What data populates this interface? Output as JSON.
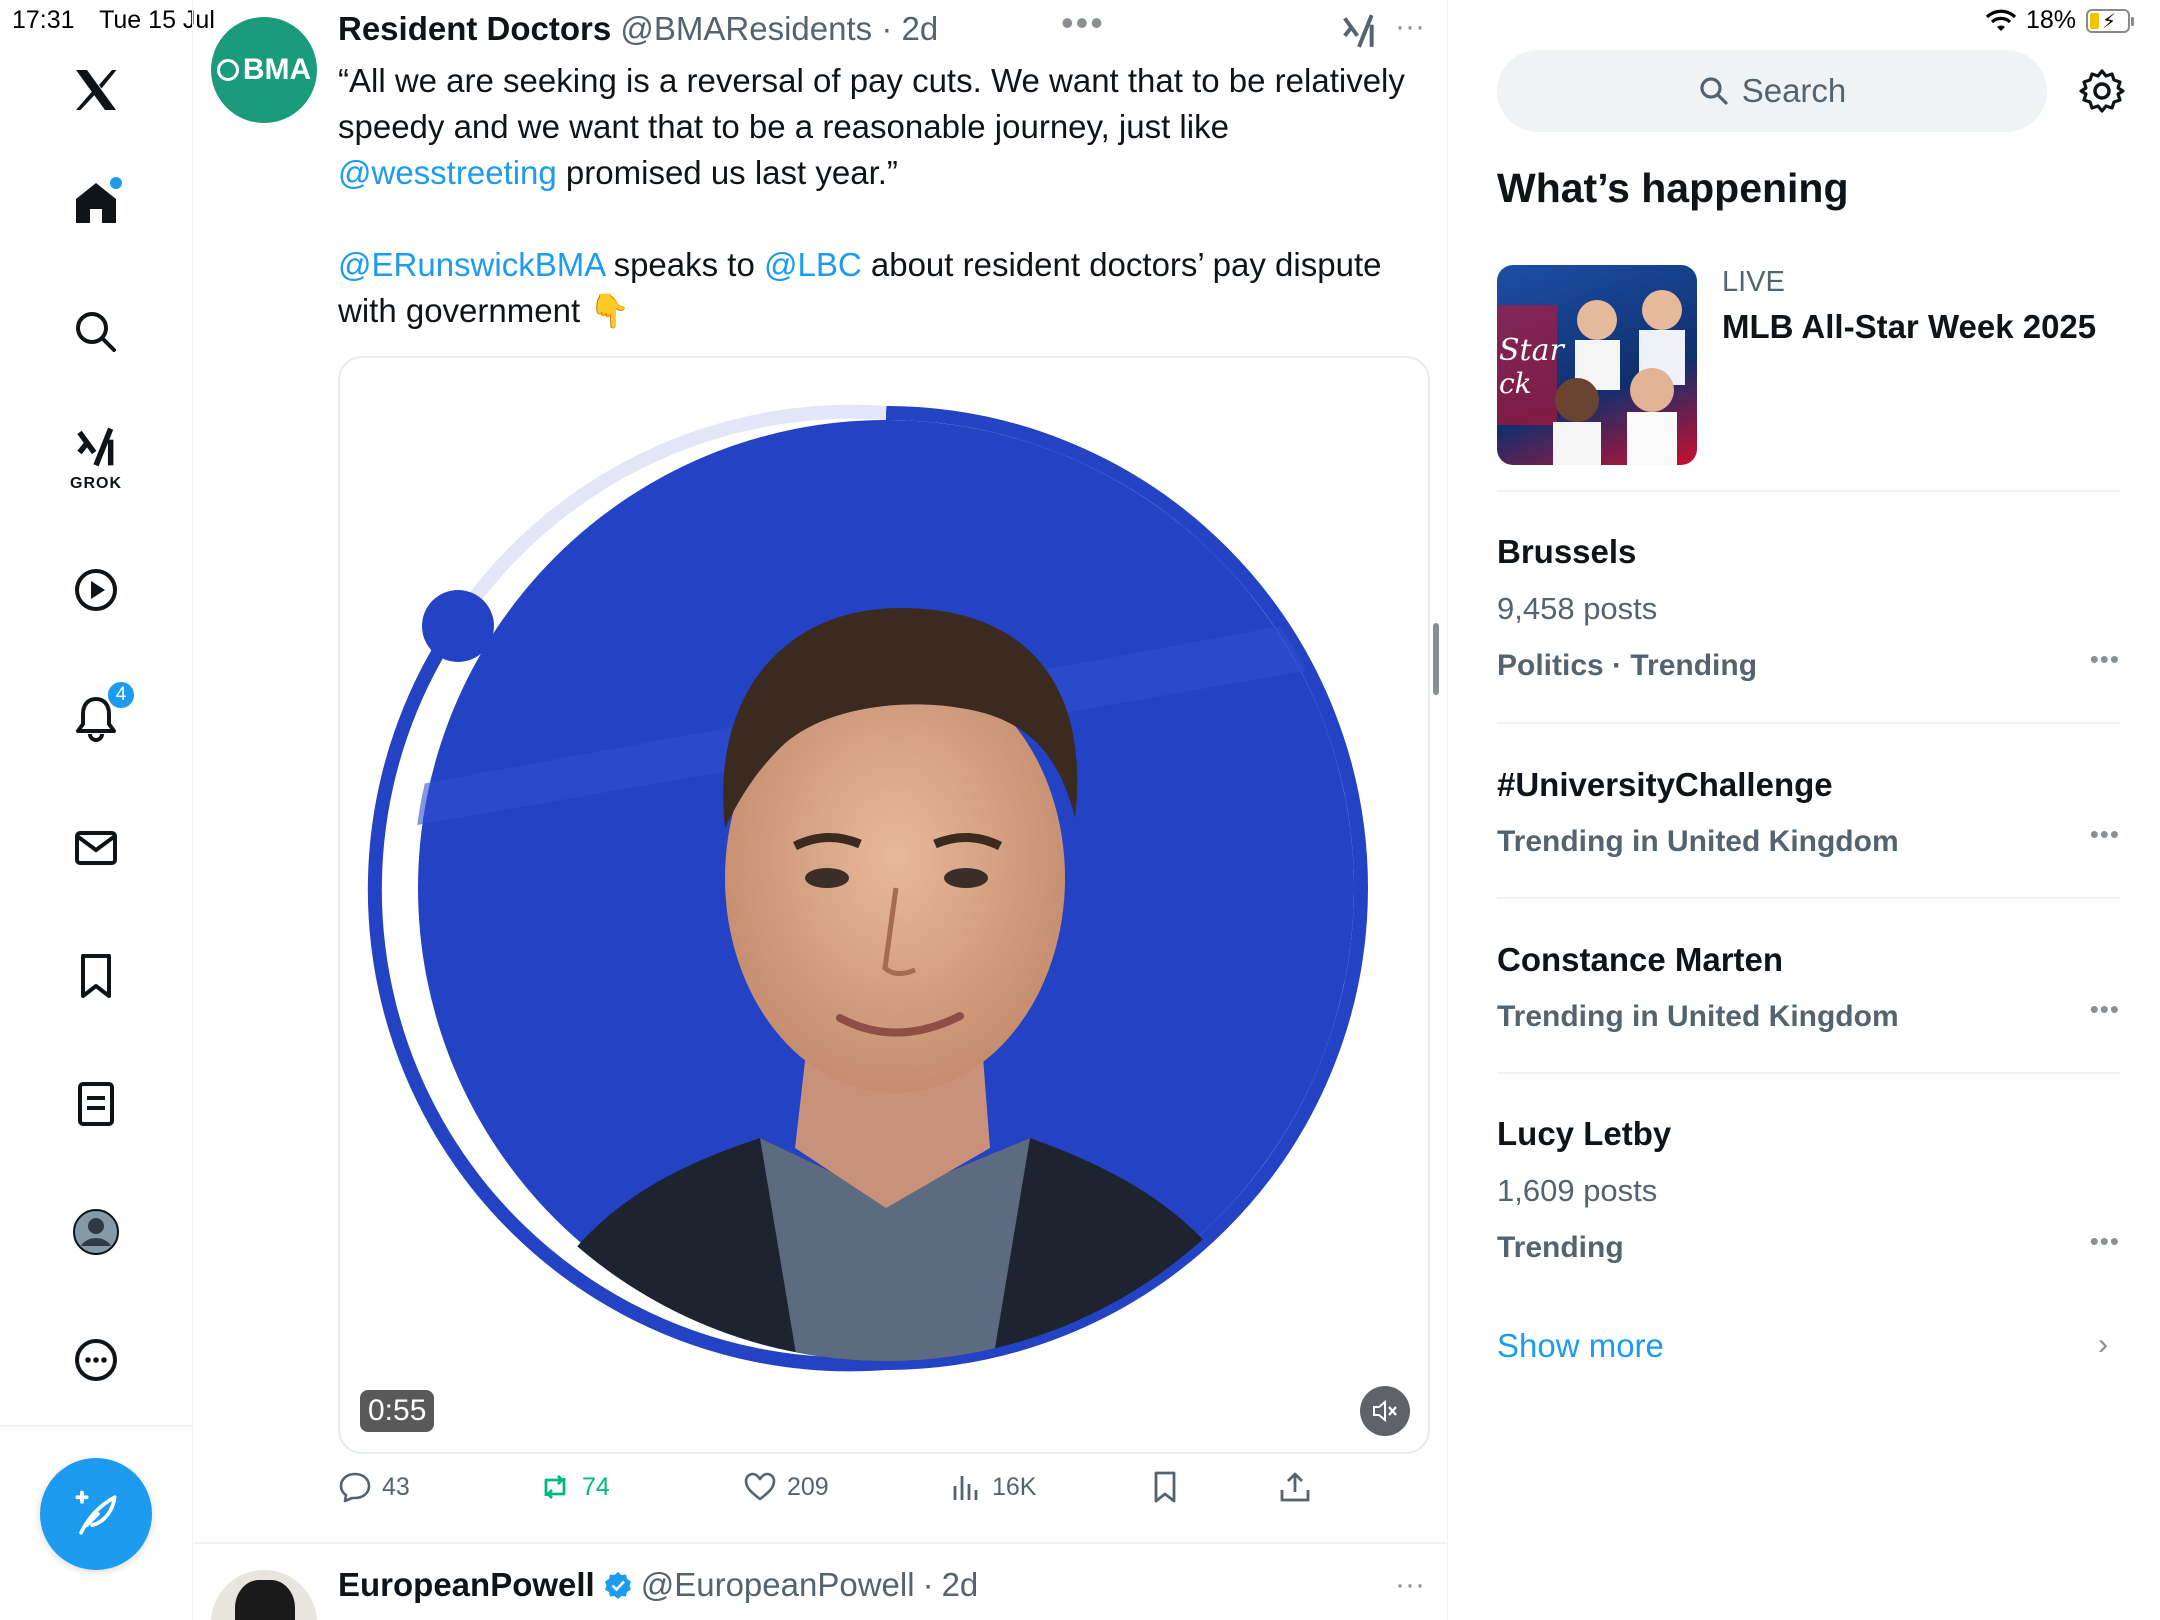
{
  "status_bar": {
    "time": "17:31",
    "date": "Tue 15 Jul",
    "battery": "18%"
  },
  "nav": {
    "grok_label": "GROK",
    "notifications_count": "4"
  },
  "tweet": {
    "author_name": "Resident Doctors",
    "author_handle": "@BMAResidents",
    "age": "2d",
    "avatar_text": "BMA",
    "text": {
      "p1_a": "“All we are seeking is a reversal of pay cuts. We want that to be relatively speedy and we want that to be a reasonable journey, just like ",
      "p1_link": "@wesstreeting",
      "p1_b": " promised us last year.”",
      "p2_link1": "@ERunswickBMA",
      "p2_a": " speaks to ",
      "p2_link2": "@LBC",
      "p2_b": " about resident doctors’ pay dispute with government 👇"
    },
    "video_duration": "0:55",
    "stats": {
      "replies": "43",
      "reposts": "74",
      "likes": "209",
      "views": "16K"
    }
  },
  "next_tweet": {
    "author_name": "EuropeanPowell",
    "author_handle": "@EuropeanPowell",
    "age": "2d"
  },
  "sidebar": {
    "search_placeholder": "Search",
    "heading": "What’s happening",
    "live": {
      "tag": "LIVE",
      "title": "MLB All-Star Week 2025"
    },
    "trends": [
      {
        "title": "Brussels",
        "posts": "9,458 posts",
        "category": "Politics · Trending"
      },
      {
        "title": "#UniversityChallenge",
        "category": "Trending in United Kingdom"
      },
      {
        "title": "Constance Marten",
        "category": "Trending in United Kingdom"
      },
      {
        "title": "Lucy Letby",
        "posts": "1,609 posts",
        "category": "Trending"
      }
    ],
    "show_more": "Show more"
  },
  "colors": {
    "accent": "#1d9bf0",
    "bma_green": "#1a9b7b",
    "video_blue": "#2442c4",
    "repost_green": "#00ba7c"
  }
}
